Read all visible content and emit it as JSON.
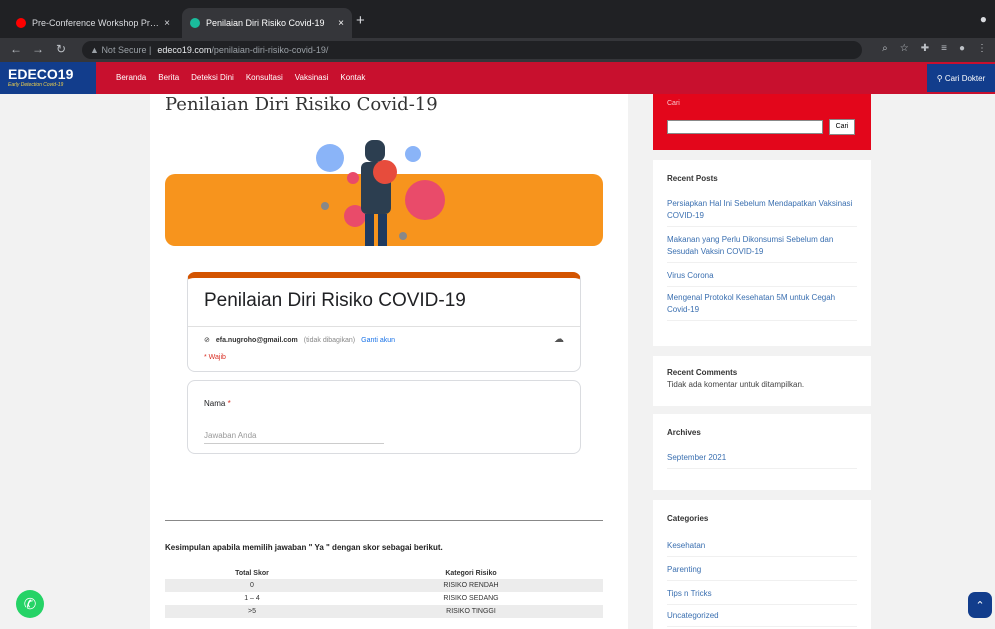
{
  "browser": {
    "tabs": [
      {
        "title": "Pre-Conference Workshop Pr…",
        "favicon_color": "#ff0000",
        "active": false
      },
      {
        "title": "Penilaian Diri Risiko Covid-19",
        "favicon_color": "#1abc9c",
        "active": true
      }
    ],
    "security_label": "Not Secure",
    "url_host": "edeco19.com",
    "url_path": "/penilaian-diri-risiko-covid-19/"
  },
  "site": {
    "logo": "EDECO19",
    "logo_tagline": "Early Detection Covid-19",
    "menu": [
      "Beranda",
      "Berita",
      "Deteksi Dini",
      "Konsultasi",
      "Vaksinasi",
      "Kontak"
    ],
    "cta": "Cari Dokter",
    "colors": {
      "primary": "#c8102e",
      "secondary": "#123d8c"
    }
  },
  "page": {
    "title": "Penilaian Diri Risiko Covid-19",
    "form": {
      "title": "Penilaian Diri Risiko COVID-19",
      "email": "efa.nugroho@gmail.com",
      "email_note": "(tidak dibagikan)",
      "switch_account": "Ganti akun",
      "required_note": "* Wajib",
      "question_label": "Nama",
      "question_placeholder": "Jawaban Anda"
    },
    "conclusion": "Kesimpulan apabila memilih jawaban \" Ya \" dengan skor sebagai berikut.",
    "table": {
      "headers": [
        "Total Skor",
        "Kategori Risiko"
      ],
      "rows": [
        [
          "0",
          "RISIKO RENDAH"
        ],
        [
          "1 – 4",
          "RISIKO SEDANG"
        ],
        [
          ">5",
          "RISIKO TINGGI"
        ]
      ]
    }
  },
  "sidebar": {
    "search_label": "Cari",
    "search_button": "Cari",
    "recent_posts_title": "Recent Posts",
    "recent_posts": [
      "Persiapkan Hal Ini Sebelum Mendapatkan Vaksinasi COVID-19",
      "Makanan yang Perlu Dikonsumsi Sebelum dan Sesudah Vaksin COVID-19",
      "Virus Corona",
      "Mengenal Protokol Kesehatan 5M untuk Cegah Covid-19"
    ],
    "recent_comments_title": "Recent Comments",
    "recent_comments_text": "Tidak ada komentar untuk ditampilkan.",
    "archives_title": "Archives",
    "archives": [
      "September 2021"
    ],
    "categories_title": "Categories",
    "categories": [
      "Kesehatan",
      "Parenting",
      "Tips n Tricks",
      "Uncategorized"
    ]
  }
}
